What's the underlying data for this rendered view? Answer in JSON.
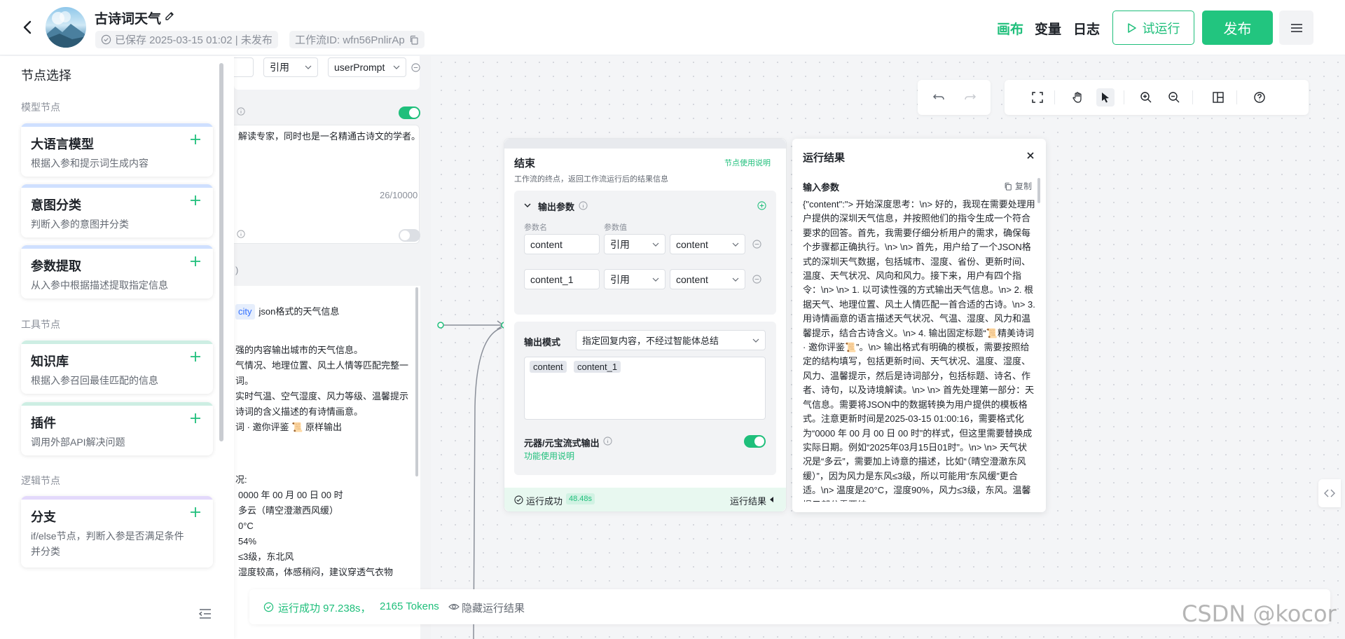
{
  "header": {
    "app_title": "古诗词天气",
    "save_status": "已保存 2025-03-15 01:02 | 未发布",
    "workflow_id": "工作流ID: wfn56PnlirAp",
    "nav": [
      "画布",
      "变量",
      "日志"
    ],
    "try_run_label": "试运行",
    "publish_label": "发布",
    "accent_color": "#1fbf7b"
  },
  "left_panel": {
    "title": "节点选择",
    "sections": [
      {
        "label": "模型节点",
        "items": [
          {
            "name": "大语言模型",
            "desc": "根据入参和提示词生成内容",
            "color": "#cfe0ff"
          },
          {
            "name": "意图分类",
            "desc": "判断入参的意图并分类",
            "color": "#cfe0ff"
          },
          {
            "name": "参数提取",
            "desc": "从入参中根据描述提取指定信息",
            "color": "#cfe0ff"
          }
        ]
      },
      {
        "label": "工具节点",
        "items": [
          {
            "name": "知识库",
            "desc": "根据入参召回最佳匹配的信息",
            "color": "#cdeee3"
          },
          {
            "name": "插件",
            "desc": "调用外部API解决问题",
            "color": "#cdeee3"
          }
        ]
      },
      {
        "label": "逻辑节点",
        "items": [
          {
            "name": "分支",
            "desc": "if/else节点，判断入参是否满足条件并分类",
            "color": "#e3d9fb"
          }
        ]
      }
    ]
  },
  "llm_node": {
    "ref_label": "引用",
    "ref_value": "userPrompt",
    "system_prompt": "解读专家，同时也是一名精通古诗文的学者。",
    "char_count": "26/10000",
    "city_tag": "city",
    "city_desc": "json格式的天气信息",
    "lines": [
      "强的内容输出城市的天气信息。",
      "气情况、地理位置、风土人情等匹配完整一",
      "词。",
      "实时气温、空气湿度、风力等级、温馨提示",
      "诗词的含义描述的有诗情画意。",
      "词 · 邀你评鉴 📜 原样输出"
    ],
    "example_label": "况:",
    "example_lines": [
      "0000 年 00 月 00 日 00 时",
      "多云（晴空澄澈西风缓）",
      "0°C",
      "54%",
      "≤3级，东北风",
      "湿度较高，体感稍闷，建议穿透气衣物"
    ]
  },
  "end_node": {
    "title": "结束",
    "help": "节点使用说明",
    "desc": "工作流的终点，返回工作流运行后的结果信息",
    "output_params_label": "输出参数",
    "col_name": "参数名",
    "col_value": "参数值",
    "params": [
      {
        "name": "content",
        "type": "引用",
        "value": "content"
      },
      {
        "name": "content_1",
        "type": "引用",
        "value": "content"
      }
    ],
    "output_mode_label": "输出模式",
    "output_mode_value": "指定回复内容，不经过智能体总结",
    "tags": [
      "content",
      "content_1"
    ],
    "stream_label": "元器/元宝流式输出",
    "stream_help": "功能使用说明",
    "run_status": "运行成功",
    "run_time": "48.48s",
    "run_result_label": "运行结果"
  },
  "result_panel": {
    "title": "运行结果",
    "input_label": "输入参数",
    "copy_label": "复制",
    "body": "{\"content\":\"> 开始深度思考：\\n> 好的，我现在需要处理用户提供的深圳天气信息，并按照他们的指令生成一个符合要求的回答。首先，我需要仔细分析用户的需求，确保每个步骤都正确执行。\\n> \\n> 首先，用户给了一个JSON格式的深圳天气数据，包括城市、湿度、省份、更新时间、温度、天气状况、风向和风力。接下来，用户有四个指令：\\n> \\n> 1. 以可读性强的方式输出天气信息。\\n> 2. 根据天气、地理位置、风土人情匹配一首合适的古诗。\\n> 3. 用诗情画意的语言描述天气状况、气温、湿度、风力和温馨提示，结合古诗含义。\\n> 4. 输出固定标题“📜精美诗词 · 邀你评鉴📜”。\\n> 输出格式有明确的模板，需要按照给定的结构填写，包括更新时间、天气状况、温度、湿度、风力、温馨提示，然后是诗词部分，包括标题、诗名、作者、诗句，以及诗境解读。\\n> \\n> 首先处理第一部分：天气信息。需要将JSON中的数据转换为用户提供的模板格式。注意更新时间是2025-03-15 01:00:16，需要格式化为“0000 年 00 月 00 日 00 时”的样式，但这里需要替换成实际日期。例如“2025年03月15日01时”。\\n> \\n> 天气状况是“多云”，需要加上诗意的描述，比如“（晴空澄澈东风缓）”，因为风力是东风≤3级，所以可能用“东风缓”更合适。\\n> 温度是20°C，湿度90%，风力≤3级，东风。温馨提示部分需要结"
  },
  "bottom_bar": {
    "run_summary": "运行成功 97.238s，",
    "tokens": "2165 Tokens",
    "hide_label": "隐藏运行结果"
  },
  "watermark": "CSDN @kocor"
}
